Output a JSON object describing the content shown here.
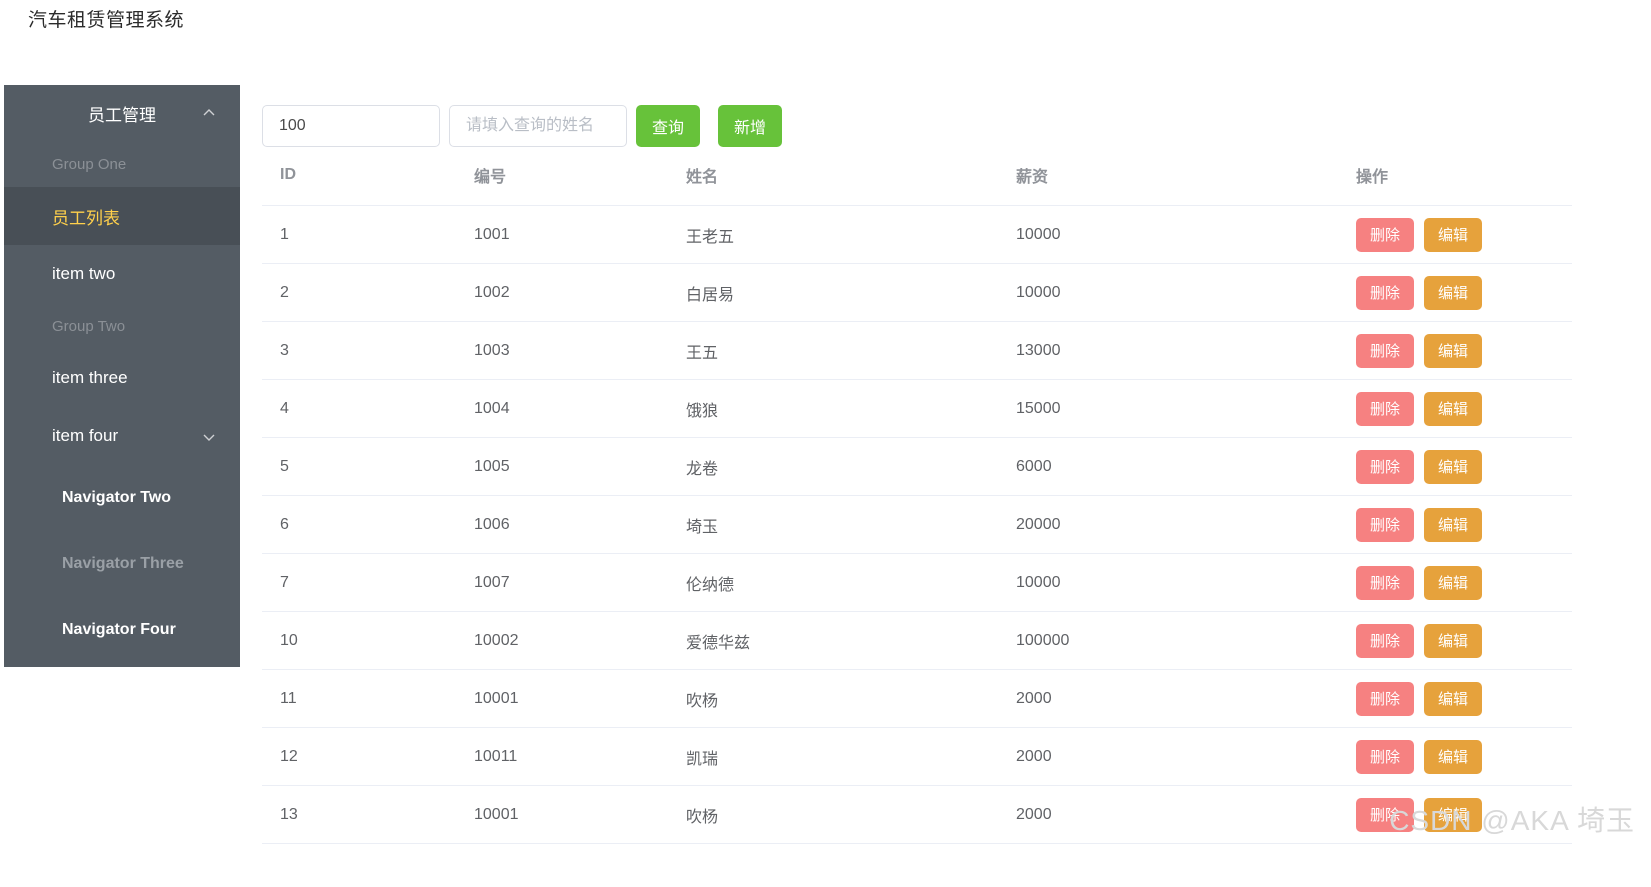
{
  "app": {
    "title": "汽车租赁管理系统"
  },
  "sidebar": {
    "menu_title": "员工管理",
    "menu_title_icon": "chevron-up-icon",
    "items": [
      {
        "label": "Group One",
        "type": "group",
        "state": "dim"
      },
      {
        "label": "员工列表",
        "type": "item",
        "state": "active"
      },
      {
        "label": "item two",
        "type": "item",
        "state": "normal"
      },
      {
        "label": "Group Two",
        "type": "group",
        "state": "dim"
      },
      {
        "label": "item three",
        "type": "item",
        "state": "normal"
      },
      {
        "label": "item four",
        "type": "item",
        "state": "normal",
        "icon": "chevron-down-icon"
      },
      {
        "label": "Navigator Two",
        "type": "sub",
        "state": "normal"
      },
      {
        "label": "Navigator Three",
        "type": "sub",
        "state": "dim"
      },
      {
        "label": "Navigator Four",
        "type": "sub",
        "state": "normal"
      }
    ]
  },
  "toolbar": {
    "count_value": "100",
    "count_placeholder": "",
    "name_value": "",
    "name_placeholder": "请填入查询的姓名",
    "search_label": "查询",
    "add_label": "新增"
  },
  "table": {
    "headers": {
      "id": "ID",
      "number": "编号",
      "name": "姓名",
      "salary": "薪资",
      "action": "操作"
    },
    "row_actions": {
      "delete_label": "删除",
      "edit_label": "编辑"
    },
    "rows": [
      {
        "id": "1",
        "number": "1001",
        "name": "王老五",
        "salary": "10000"
      },
      {
        "id": "2",
        "number": "1002",
        "name": "白居易",
        "salary": "10000"
      },
      {
        "id": "3",
        "number": "1003",
        "name": "王五",
        "salary": "13000"
      },
      {
        "id": "4",
        "number": "1004",
        "name": "饿狼",
        "salary": "15000"
      },
      {
        "id": "5",
        "number": "1005",
        "name": "龙卷",
        "salary": "6000"
      },
      {
        "id": "6",
        "number": "1006",
        "name": "埼玉",
        "salary": "20000"
      },
      {
        "id": "7",
        "number": "1007",
        "name": "伦纳德",
        "salary": "10000"
      },
      {
        "id": "10",
        "number": "10002",
        "name": "爱德华兹",
        "salary": "100000"
      },
      {
        "id": "11",
        "number": "10001",
        "name": "吹杨",
        "salary": "2000"
      },
      {
        "id": "12",
        "number": "10011",
        "name": "凯瑞",
        "salary": "2000"
      },
      {
        "id": "13",
        "number": "10001",
        "name": "吹杨",
        "salary": "2000"
      }
    ]
  },
  "watermark": {
    "text": "CSDN @AKA 埼玉"
  },
  "colors": {
    "sidebar_bg": "#545c64",
    "sidebar_active_bg": "#484f56",
    "sidebar_active_text": "#ffd04b",
    "primary_green": "#67c23a",
    "danger_red": "#f56c6c",
    "warning_orange": "#e6a23c"
  }
}
